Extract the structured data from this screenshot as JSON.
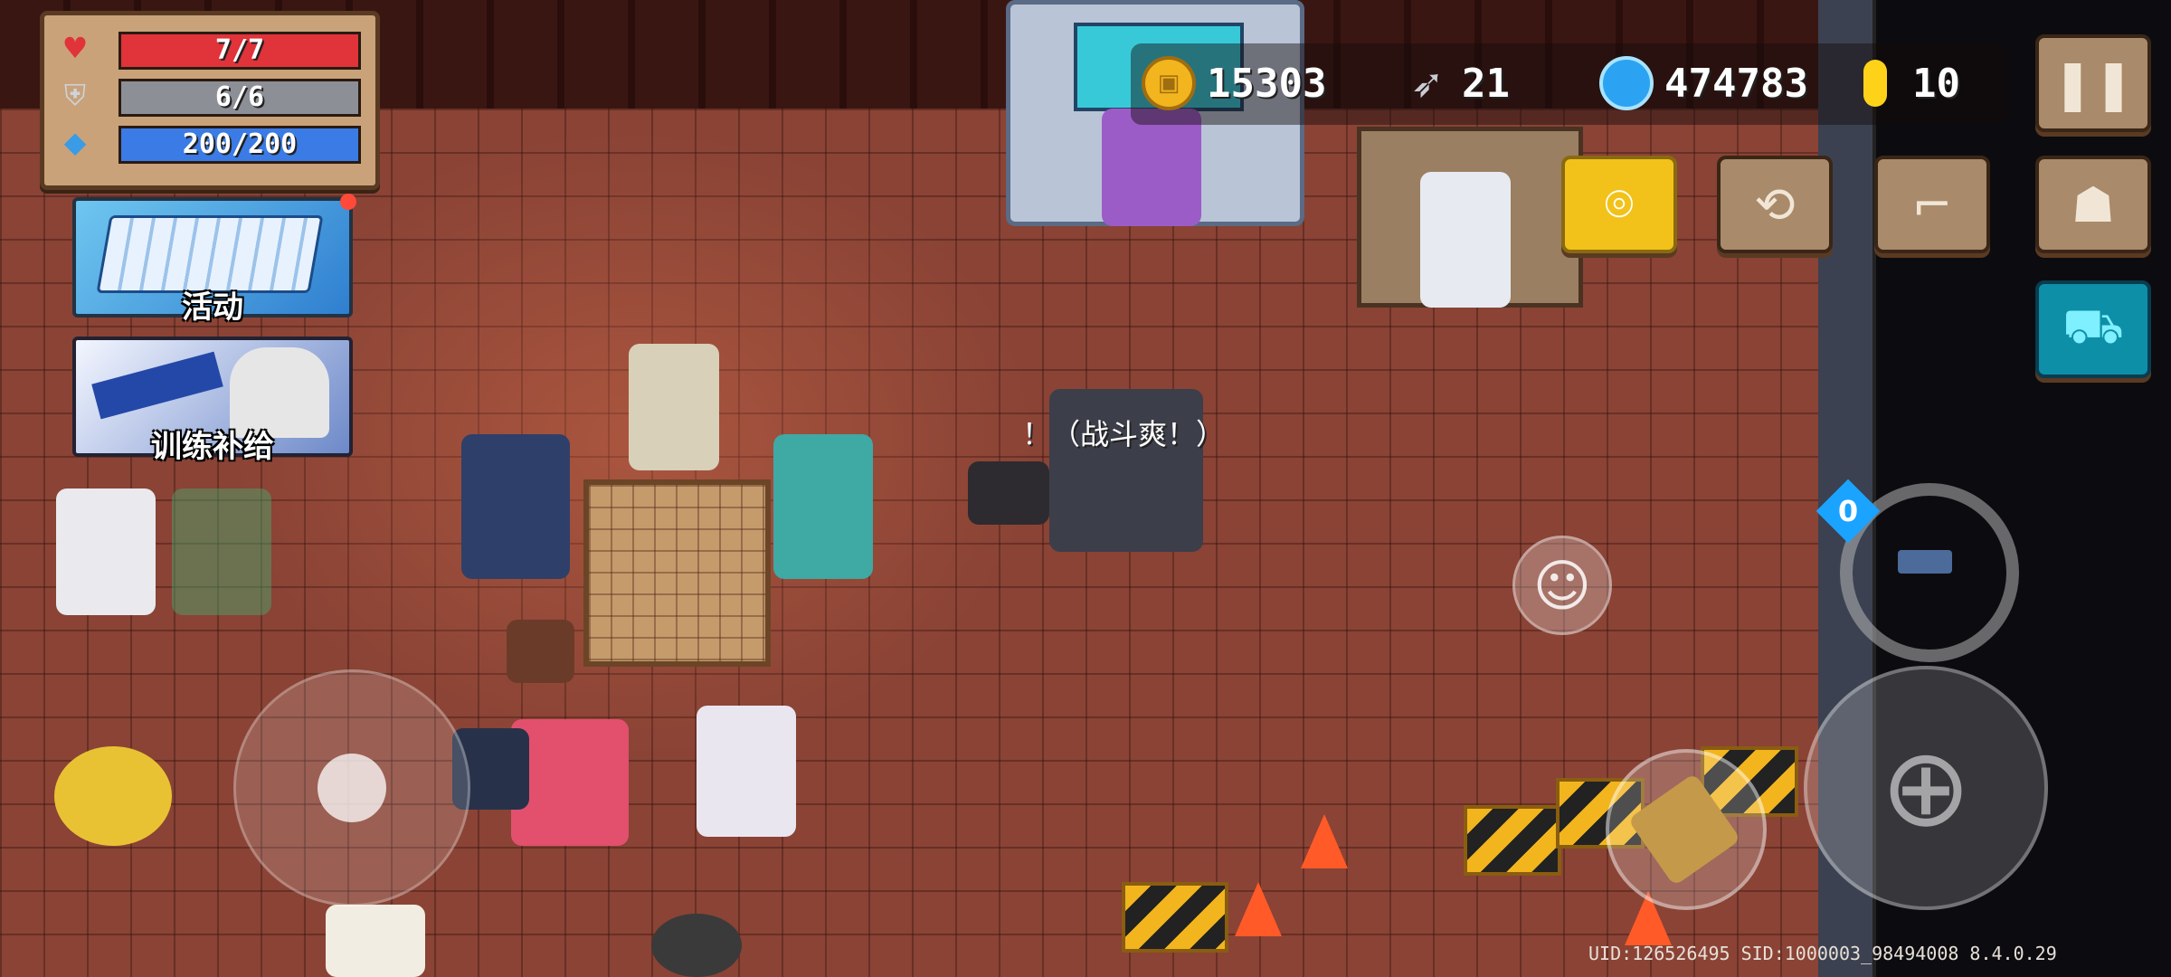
{
  "stats": {
    "health": {
      "text": "7/7",
      "fraction": 1.0,
      "color": "#e0333a"
    },
    "armor": {
      "text": "6/6",
      "fraction": 1.0,
      "color": "#8c8f96"
    },
    "energy": {
      "text": "200/200",
      "fraction": 1.0,
      "color": "#3a7be6"
    }
  },
  "cards": {
    "event_label": "活动",
    "supply_label": "训练补给"
  },
  "currencies": {
    "gold": "15303",
    "fish": "21",
    "gems": "474783",
    "tokens": "10"
  },
  "speech_text": "！（战斗爽！）",
  "weapon": {
    "energy_cost": "0"
  },
  "footer": {
    "uid_line": "UID:126526495 SID:1000003_98494008 8.4.0.29"
  },
  "colors": {
    "accent_yellow": "#f2c21a",
    "shop_cyan": "#0e8fa8",
    "button_tan": "#a98a6a"
  },
  "icons": {
    "pause": "pause-icon",
    "location": "map-pin-icon",
    "refresh": "swap-icon",
    "stairs": "stairs-icon",
    "profile": "profile-card-icon",
    "shop": "shopping-cart-icon",
    "emote": "smiley-icon"
  }
}
